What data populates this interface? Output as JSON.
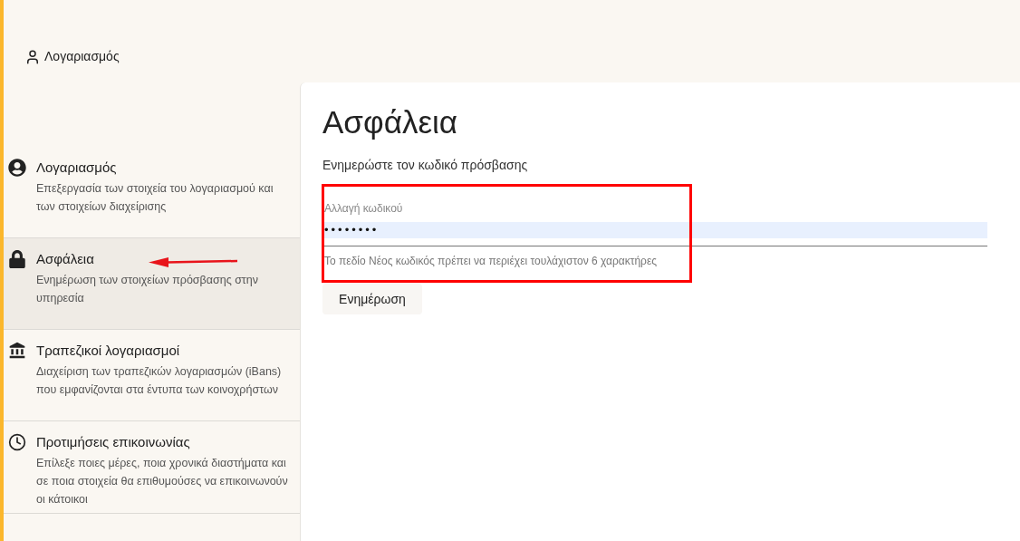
{
  "header": {
    "account_link": "Λογαριασμός"
  },
  "sidebar": {
    "items": [
      {
        "kind": "account",
        "title": "Λογαριασμός",
        "description": "Επεξεργασία των στοιχεία του λογαριασμού και των στοιχείων διαχείρισης",
        "selected": false
      },
      {
        "kind": "security",
        "title": "Ασφάλεια",
        "description": "Ενημέρωση των στοιχείων πρόσβασης στην υπηρεσία",
        "selected": true
      },
      {
        "kind": "bank",
        "title": "Τραπεζικοί λογαριασμοί",
        "description": "Διαχείριση των τραπεζικών λογαριασμών (iBans) που εμφανίζονται στα έντυπα των κοινοχρήστων",
        "selected": false
      },
      {
        "kind": "contact",
        "title": "Προτιμήσεις επικοινωνίας",
        "description": "Επίλεξε ποιες μέρες, ποια χρονικά διαστήματα και σε ποια στοιχεία θα επιθυμούσες να επικοινωνούν οι κάτοικοι",
        "selected": false
      }
    ]
  },
  "main": {
    "title": "Ασφάλεια",
    "subtitle": "Ενημερώστε τον κωδικό πρόσβασης",
    "password_field": {
      "label": "Αλλαγή κωδικού",
      "value": "••••••••",
      "helper": "Το πεδίο Νέος κωδικός πρέπει να περιέχει τουλάχιστον 6 χαρακτήρες"
    },
    "button": "Ενημέρωση"
  }
}
